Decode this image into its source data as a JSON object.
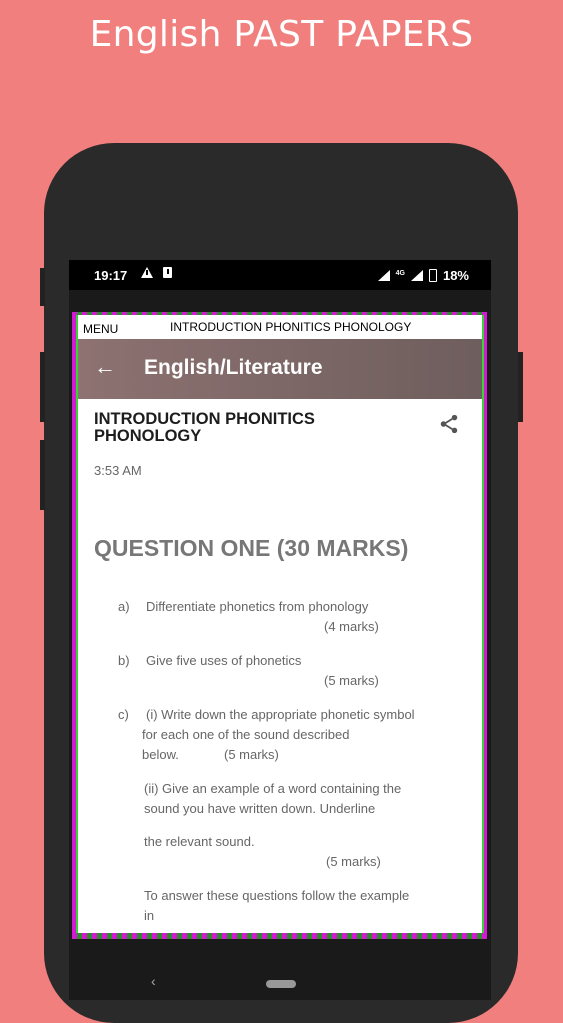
{
  "promo": {
    "title": "English PAST PAPERS"
  },
  "status_bar": {
    "time": "19:17",
    "network": "4G",
    "battery": "18%"
  },
  "menu_bar": {
    "menu_label": "MENU",
    "title": "INTRODUCTION PHONITICS PHONOLOGY"
  },
  "app_bar": {
    "back_icon": "arrow-left-icon",
    "title": "English/Literature"
  },
  "post": {
    "title": "INTRODUCTION PHONITICS PHONOLOGY",
    "share_icon": "share-icon",
    "time": "3:53 AM",
    "question_heading": "QUESTION ONE (30 MARKS)",
    "items": [
      {
        "letter": "a)",
        "text": "Differentiate phonetics from phonology",
        "marks": "(4 marks)"
      },
      {
        "letter": "b)",
        "text": "Give five uses of phonetics",
        "marks": "(5 marks)"
      },
      {
        "letter": "c)",
        "text_line1": "(i) Write down the appropriate phonetic symbol",
        "text_line2": "for each one of the sound described",
        "text_line3": "below.",
        "marks": "(5 marks)"
      }
    ],
    "sub_ii_line1": "(ii) Give an example of a word containing the",
    "sub_ii_line2": "sound you have written down. Underline",
    "sub_ii_line3": "the relevant sound.",
    "sub_ii_marks": "(5 marks)",
    "footer_line1": "To answer these questions follow the example",
    "footer_line2": "in"
  },
  "nav": {
    "back_icon": "chevron-left-icon",
    "home_icon": "home-pill-icon"
  }
}
